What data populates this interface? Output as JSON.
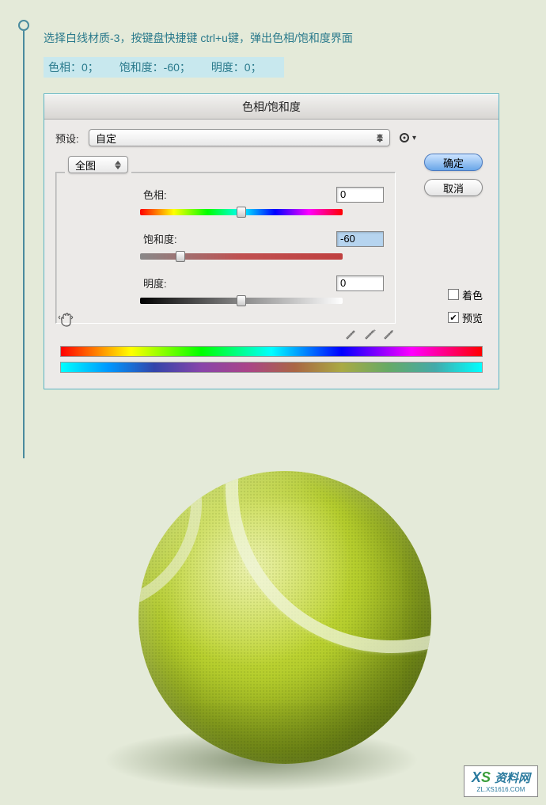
{
  "instruction": "选择白线材质-3，按键盘快捷键 ctrl+u键，弹出色相/饱和度界面",
  "highlights": {
    "hue": "色相：0；",
    "sat": "饱和度：-60；",
    "light": "明度：0；"
  },
  "dialog": {
    "title": "色相/饱和度",
    "preset_label": "预设:",
    "preset_value": "自定",
    "ok": "确定",
    "cancel": "取消",
    "scope": "全图",
    "sliders": {
      "hue_label": "色相:",
      "hue_value": "0",
      "sat_label": "饱和度:",
      "sat_value": "-60",
      "light_label": "明度:",
      "light_value": "0"
    },
    "colorize": "着色",
    "preview": "预览"
  },
  "watermark": {
    "brand_x": "X",
    "brand_s": "S",
    "brand_text": "资料网",
    "url": "ZL.XS1616.COM"
  }
}
